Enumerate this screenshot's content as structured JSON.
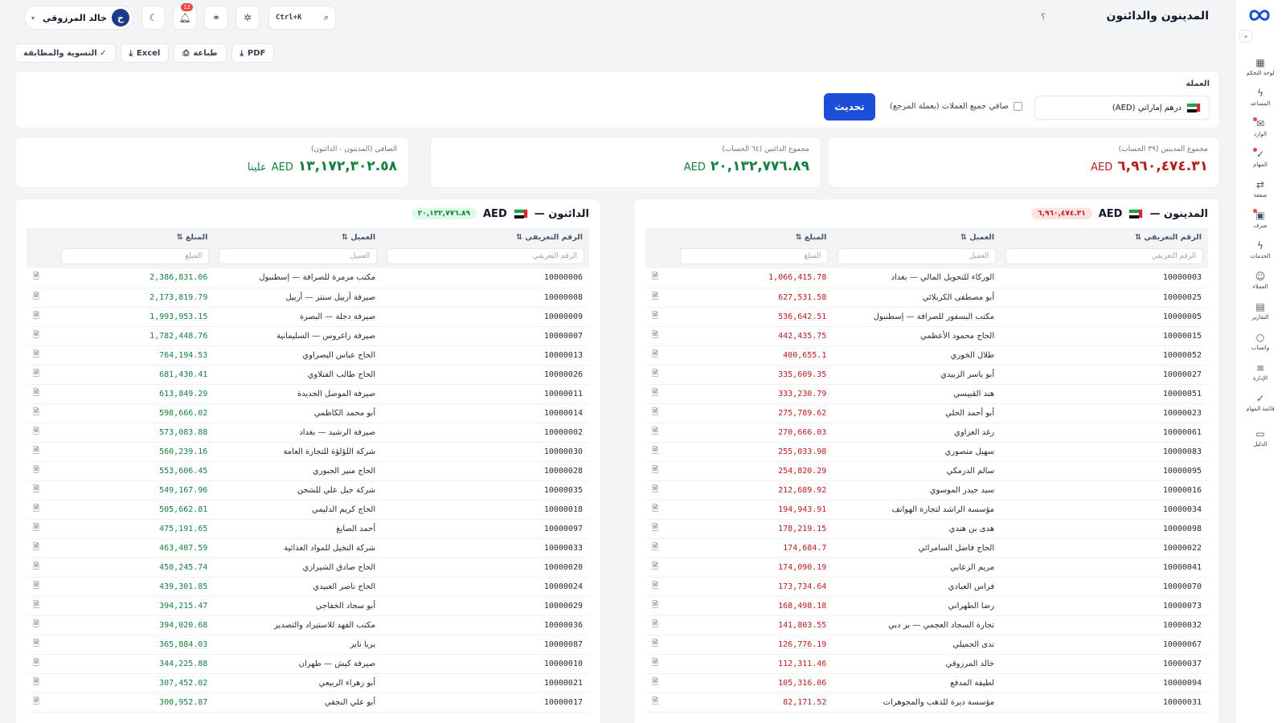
{
  "topbar": {
    "page_title": "المدينون والدائنون",
    "help": "؟",
    "search_shortcut": "Ctrl+K",
    "notifications_count": "12",
    "user_name": "خالد المرزوقي",
    "user_initial": "خ"
  },
  "sidebar": {
    "items": [
      {
        "label": "لوحة التحكم",
        "icon": "dashboard-icon",
        "glyph": "▦"
      },
      {
        "label": "المساعد",
        "icon": "bolt-icon",
        "glyph": "ϟ"
      },
      {
        "label": "الوارد",
        "icon": "inbox-icon",
        "glyph": "✉"
      },
      {
        "label": "المهام",
        "icon": "check-icon",
        "glyph": "✓"
      },
      {
        "label": "صفقة",
        "icon": "exchange-icon",
        "glyph": "⇄"
      },
      {
        "label": "صرف",
        "icon": "camera-icon",
        "glyph": "▣"
      },
      {
        "label": "الخدمات",
        "icon": "bolt-icon",
        "glyph": "ϟ"
      },
      {
        "label": "العملاء",
        "icon": "users-icon",
        "glyph": "☺"
      },
      {
        "label": "التقارير",
        "icon": "report-icon",
        "glyph": "▤"
      },
      {
        "label": "واتساب",
        "icon": "chat-icon",
        "glyph": "○"
      },
      {
        "label": "الإدارة",
        "icon": "sliders-icon",
        "glyph": "≡"
      },
      {
        "label": "قائمة المهام",
        "icon": "check-icon",
        "glyph": "✓"
      },
      {
        "label": "الدليل",
        "icon": "book-icon",
        "glyph": "▭"
      }
    ]
  },
  "actions": {
    "reconcile": "✓ التسوية والمطابقة",
    "excel": "Excel",
    "print": "طباعة",
    "pdf": "PDF"
  },
  "filter": {
    "label": "العملة",
    "currency_value": "درهم إماراتي (AED)",
    "net_all_label": "صافي جميع العملات (بعملة المرجع)",
    "refresh": "تحديث"
  },
  "stats": {
    "debtors_label": "مجموع المدينين (٣٩ الحساب)",
    "debtors_value": "٦,٩٦٠,٤٧٤.٣١",
    "creditors_label": "مجموع الدائنين (٦٤ الحساب)",
    "creditors_value": "٢٠,١٣٢,٧٧٦.٨٩",
    "net_label": "الصافي (المدينون - الدائنون)",
    "net_value": "١٣,١٧٢,٣٠٢.٥٨",
    "net_suffix": "علينا",
    "currency": "AED",
    "colors": {
      "debit": "#b91c1c",
      "credit": "#15803d"
    }
  },
  "debtors": {
    "title": "المدينون —",
    "currency": "AED",
    "total": "٦,٩٦٠,٤٧٤.٣١",
    "headers": {
      "id": "الرقم التعريفي ⇅",
      "client": "العميل ⇅",
      "amount": "المبلغ ⇅"
    },
    "placeholders": {
      "id": "الرقم التعريفي",
      "client": "العميل",
      "amount": "المبلغ"
    },
    "rows": [
      {
        "id": "10000003",
        "client": "الوركاء للتحويل المالي — بغداد",
        "amount": "1,066,415.78"
      },
      {
        "id": "10000025",
        "client": "أبو مصطفى الكربلائي",
        "amount": "627,531.58"
      },
      {
        "id": "10000005",
        "client": "مكتب البسفور للصرافة — إسطنبول",
        "amount": "536,642.51"
      },
      {
        "id": "10000015",
        "client": "الحاج محمود الأعظمي",
        "amount": "442,435.75"
      },
      {
        "id": "10000052",
        "client": "طلال الخوري",
        "amount": "400,655.1"
      },
      {
        "id": "10000027",
        "client": "أبو ياسر الزبيدي",
        "amount": "335,609.35"
      },
      {
        "id": "10000051",
        "client": "هند القبيسي",
        "amount": "333,230.79"
      },
      {
        "id": "10000023",
        "client": "أبو أحمد الحلي",
        "amount": "275,789.62"
      },
      {
        "id": "10000061",
        "client": "رغد العزاوي",
        "amount": "270,666.03"
      },
      {
        "id": "10000083",
        "client": "سهيل منصوري",
        "amount": "255,033.98"
      },
      {
        "id": "10000095",
        "client": "سالم الدرمكي",
        "amount": "254,820.29"
      },
      {
        "id": "10000016",
        "client": "سيد حيدر الموسوي",
        "amount": "212,689.92"
      },
      {
        "id": "10000034",
        "client": "مؤسسة الراشد لتجارة الهواتف",
        "amount": "194,943.91"
      },
      {
        "id": "10000098",
        "client": "هدى بن هندي",
        "amount": "178,219.15"
      },
      {
        "id": "10000022",
        "client": "الحاج فاضل السامرائي",
        "amount": "174,684.7"
      },
      {
        "id": "10000041",
        "client": "مريم الزعابي",
        "amount": "174,090.19"
      },
      {
        "id": "10000070",
        "client": "فراس العبادي",
        "amount": "173,734.64"
      },
      {
        "id": "10000073",
        "client": "رضا الطهراني",
        "amount": "168,498.18"
      },
      {
        "id": "10000032",
        "client": "تجارة السجاد العجمي — بر دبي",
        "amount": "141,803.55"
      },
      {
        "id": "10000067",
        "client": "ندى الجميلي",
        "amount": "126,776.19"
      },
      {
        "id": "10000037",
        "client": "خالد المرزوقي",
        "amount": "112,311.46"
      },
      {
        "id": "10000094",
        "client": "لطيفة المدفع",
        "amount": "105,316.06"
      },
      {
        "id": "10000031",
        "client": "مؤسسة ديرة للذهب والمجوهرات",
        "amount": "82,171.52"
      }
    ]
  },
  "creditors": {
    "title": "الدائنون —",
    "currency": "AED",
    "total": "٢٠,١٣٢,٧٧٦.٨٩",
    "headers": {
      "id": "الرقم التعريفي ⇅",
      "client": "العميل ⇅",
      "amount": "المبلغ ⇅"
    },
    "placeholders": {
      "id": "الرقم التعريفي",
      "client": "العميل",
      "amount": "المبلغ"
    },
    "rows": [
      {
        "id": "10000006",
        "client": "مكتب مرمرة للصرافة — إسطنبول",
        "amount": "2,386,831.06"
      },
      {
        "id": "10000008",
        "client": "صيرفة أربيل سنتر — أربيل",
        "amount": "2,173,819.79"
      },
      {
        "id": "10000009",
        "client": "صيرفة دجلة — البصرة",
        "amount": "1,993,953.15"
      },
      {
        "id": "10000007",
        "client": "صيرفة زاغروس — السليمانية",
        "amount": "1,782,448.76"
      },
      {
        "id": "10000013",
        "client": "الحاج عباس البصراوي",
        "amount": "764,194.53"
      },
      {
        "id": "10000026",
        "client": "الحاج طالب الفتلاوي",
        "amount": "681,430.41"
      },
      {
        "id": "10000011",
        "client": "صيرفة الموصل الجديدة",
        "amount": "613,849.29"
      },
      {
        "id": "10000014",
        "client": "أبو محمد الكاظمي",
        "amount": "598,666.02"
      },
      {
        "id": "10000002",
        "client": "صيرفة الرشيد — بغداد",
        "amount": "573,083.88"
      },
      {
        "id": "10000030",
        "client": "شركة اللؤلؤة للتجارة العامة",
        "amount": "560,239.16"
      },
      {
        "id": "10000028",
        "client": "الحاج منير الجبوري",
        "amount": "553,606.45"
      },
      {
        "id": "10000035",
        "client": "شركة جبل علي للشحن",
        "amount": "549,167.96"
      },
      {
        "id": "10000018",
        "client": "الحاج كريم الدليمي",
        "amount": "505,662.81"
      },
      {
        "id": "10000097",
        "client": "أحمد الصايغ",
        "amount": "475,191.65"
      },
      {
        "id": "10000033",
        "client": "شركة النخيل للمواد الغذائية",
        "amount": "463,407.59"
      },
      {
        "id": "10000020",
        "client": "الحاج صادق الشيرازي",
        "amount": "450,245.74"
      },
      {
        "id": "10000024",
        "client": "الحاج ناصر العبيدي",
        "amount": "439,301.85"
      },
      {
        "id": "10000029",
        "client": "أبو سجاد الخفاجي",
        "amount": "394,215.47"
      },
      {
        "id": "10000036",
        "client": "مكتب الفهد للاستيراد والتصدير",
        "amount": "394,020.68"
      },
      {
        "id": "10000087",
        "client": "بريا ناير",
        "amount": "365,884.03"
      },
      {
        "id": "10000010",
        "client": "صيرفة كيش — طهران",
        "amount": "344,225.88"
      },
      {
        "id": "10000021",
        "client": "أبو زهراء الربيعي",
        "amount": "307,452.02"
      },
      {
        "id": "10000017",
        "client": "أبو علي النجفي",
        "amount": "300,952.87"
      }
    ]
  }
}
